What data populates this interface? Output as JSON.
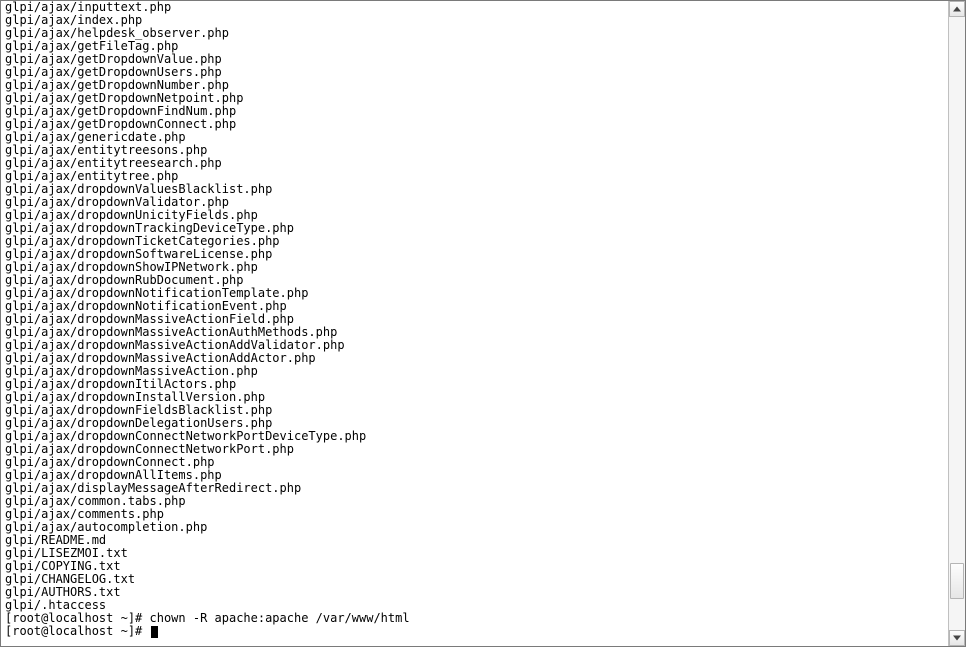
{
  "terminal": {
    "output_lines": [
      "glpi/ajax/inputtext.php",
      "glpi/ajax/index.php",
      "glpi/ajax/helpdesk_observer.php",
      "glpi/ajax/getFileTag.php",
      "glpi/ajax/getDropdownValue.php",
      "glpi/ajax/getDropdownUsers.php",
      "glpi/ajax/getDropdownNumber.php",
      "glpi/ajax/getDropdownNetpoint.php",
      "glpi/ajax/getDropdownFindNum.php",
      "glpi/ajax/getDropdownConnect.php",
      "glpi/ajax/genericdate.php",
      "glpi/ajax/entitytreesons.php",
      "glpi/ajax/entitytreesearch.php",
      "glpi/ajax/entitytree.php",
      "glpi/ajax/dropdownValuesBlacklist.php",
      "glpi/ajax/dropdownValidator.php",
      "glpi/ajax/dropdownUnicityFields.php",
      "glpi/ajax/dropdownTrackingDeviceType.php",
      "glpi/ajax/dropdownTicketCategories.php",
      "glpi/ajax/dropdownSoftwareLicense.php",
      "glpi/ajax/dropdownShowIPNetwork.php",
      "glpi/ajax/dropdownRubDocument.php",
      "glpi/ajax/dropdownNotificationTemplate.php",
      "glpi/ajax/dropdownNotificationEvent.php",
      "glpi/ajax/dropdownMassiveActionField.php",
      "glpi/ajax/dropdownMassiveActionAuthMethods.php",
      "glpi/ajax/dropdownMassiveActionAddValidator.php",
      "glpi/ajax/dropdownMassiveActionAddActor.php",
      "glpi/ajax/dropdownMassiveAction.php",
      "glpi/ajax/dropdownItilActors.php",
      "glpi/ajax/dropdownInstallVersion.php",
      "glpi/ajax/dropdownFieldsBlacklist.php",
      "glpi/ajax/dropdownDelegationUsers.php",
      "glpi/ajax/dropdownConnectNetworkPortDeviceType.php",
      "glpi/ajax/dropdownConnectNetworkPort.php",
      "glpi/ajax/dropdownConnect.php",
      "glpi/ajax/dropdownAllItems.php",
      "glpi/ajax/displayMessageAfterRedirect.php",
      "glpi/ajax/common.tabs.php",
      "glpi/ajax/comments.php",
      "glpi/ajax/autocompletion.php",
      "glpi/README.md",
      "glpi/LISEZMOI.txt",
      "glpi/COPYING.txt",
      "glpi/CHANGELOG.txt",
      "glpi/AUTHORS.txt",
      "glpi/.htaccess"
    ],
    "prev_command": {
      "prompt": "[root@localhost ~]# ",
      "command": "chown -R apache:apache /var/www/html"
    },
    "current_prompt": {
      "prompt": "[root@localhost ~]# ",
      "command": ""
    }
  },
  "scrollbar": {
    "thumb_top_pct": 89,
    "thumb_height_pct": 6
  }
}
